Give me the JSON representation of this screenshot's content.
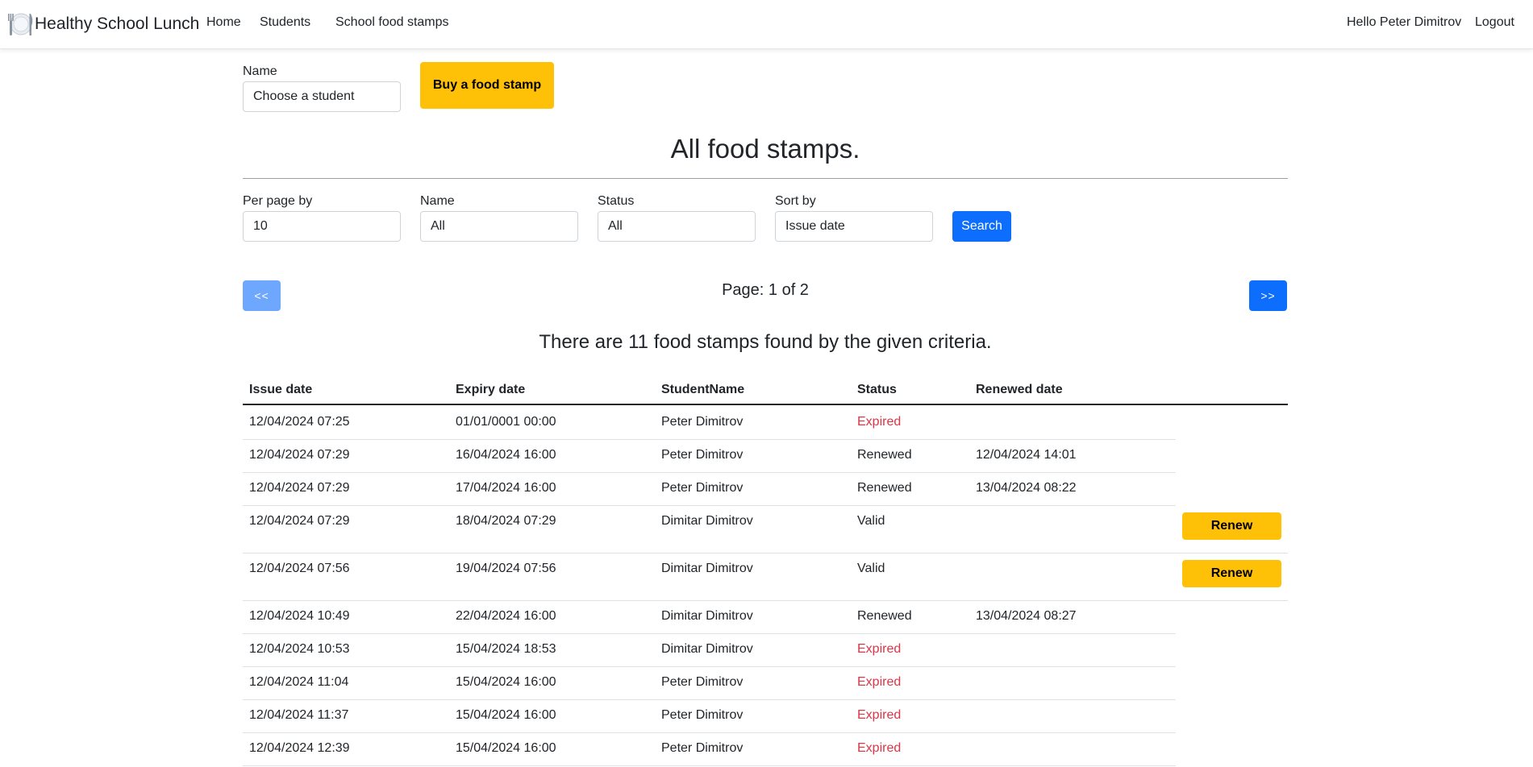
{
  "navbar": {
    "brand": "Healthy School Lunch",
    "links": [
      "Home",
      "Students",
      "School food stamps"
    ],
    "greeting": "Hello Peter Dimitrov",
    "logout": "Logout"
  },
  "buy_form": {
    "name_label": "Name",
    "name_value": "Choose a student",
    "buy_button": "Buy a food stamp"
  },
  "page_title": "All food stamps.",
  "filters": {
    "per_page_label": "Per page by",
    "per_page_value": "10",
    "name_label": "Name",
    "name_value": "All",
    "status_label": "Status",
    "status_value": "All",
    "sort_label": "Sort by",
    "sort_value": "Issue date",
    "search_button": "Search"
  },
  "pagination": {
    "prev": "<<",
    "next": ">>",
    "info": "Page: 1 of 2"
  },
  "result_count": "There are 11 food stamps found by the given criteria.",
  "table": {
    "headers": [
      "Issue date",
      "Expiry date",
      "StudentName",
      "Status",
      "Renewed date"
    ],
    "renew_label": "Renew",
    "rows": [
      {
        "issue": "12/04/2024 07:25",
        "expiry": "01/01/0001 00:00",
        "student": "Peter Dimitrov",
        "status": "Expired",
        "renewed": ""
      },
      {
        "issue": "12/04/2024 07:29",
        "expiry": "16/04/2024 16:00",
        "student": "Peter Dimitrov",
        "status": "Renewed",
        "renewed": "12/04/2024 14:01"
      },
      {
        "issue": "12/04/2024 07:29",
        "expiry": "17/04/2024 16:00",
        "student": "Peter Dimitrov",
        "status": "Renewed",
        "renewed": "13/04/2024 08:22"
      },
      {
        "issue": "12/04/2024 07:29",
        "expiry": "18/04/2024 07:29",
        "student": "Dimitar Dimitrov",
        "status": "Valid",
        "renewed": ""
      },
      {
        "issue": "12/04/2024 07:56",
        "expiry": "19/04/2024 07:56",
        "student": "Dimitar Dimitrov",
        "status": "Valid",
        "renewed": ""
      },
      {
        "issue": "12/04/2024 10:49",
        "expiry": "22/04/2024 16:00",
        "student": "Dimitar Dimitrov",
        "status": "Renewed",
        "renewed": "13/04/2024 08:27"
      },
      {
        "issue": "12/04/2024 10:53",
        "expiry": "15/04/2024 18:53",
        "student": "Dimitar Dimitrov",
        "status": "Expired",
        "renewed": ""
      },
      {
        "issue": "12/04/2024 11:04",
        "expiry": "15/04/2024 16:00",
        "student": "Peter Dimitrov",
        "status": "Expired",
        "renewed": ""
      },
      {
        "issue": "12/04/2024 11:37",
        "expiry": "15/04/2024 16:00",
        "student": "Peter Dimitrov",
        "status": "Expired",
        "renewed": ""
      },
      {
        "issue": "12/04/2024 12:39",
        "expiry": "15/04/2024 16:00",
        "student": "Peter Dimitrov",
        "status": "Expired",
        "renewed": ""
      }
    ]
  },
  "colors": {
    "primary": "#0d6efd",
    "primary_disabled": "#6ea8fe",
    "warning": "#ffc107",
    "danger": "#dc3545"
  },
  "icons": {
    "brand_logo": "plate-fork-knife-icon"
  }
}
